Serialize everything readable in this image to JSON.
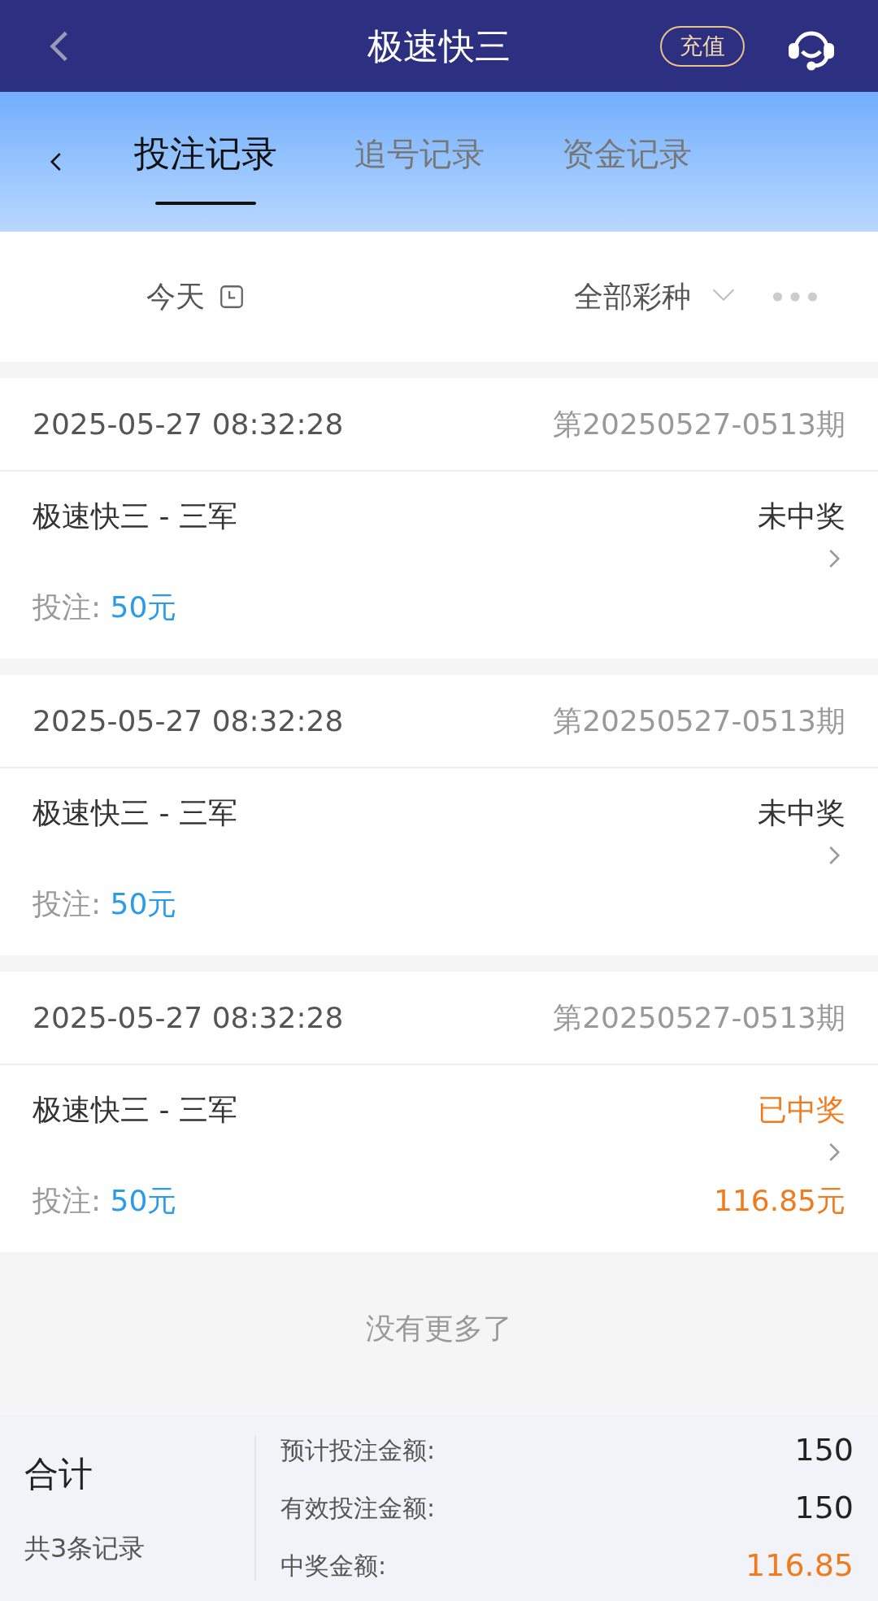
{
  "header": {
    "title": "极速快三",
    "recharge": "充值"
  },
  "tabs": [
    {
      "label": "投注记录",
      "selected": true
    },
    {
      "label": "追号记录",
      "selected": false
    },
    {
      "label": "资金记录",
      "selected": false
    }
  ],
  "filters": {
    "date": "今天",
    "lottery": "全部彩种"
  },
  "records": [
    {
      "time": "2025-05-27 08:32:28",
      "issue": "第20250527-0513期",
      "game": "极速快三 - 三军",
      "status": "未中奖",
      "won": false,
      "bet_label": "投注:",
      "bet": "50元"
    },
    {
      "time": "2025-05-27 08:32:28",
      "issue": "第20250527-0513期",
      "game": "极速快三 - 三军",
      "status": "未中奖",
      "won": false,
      "bet_label": "投注:",
      "bet": "50元"
    },
    {
      "time": "2025-05-27 08:32:28",
      "issue": "第20250527-0513期",
      "game": "极速快三 - 三军",
      "status": "已中奖",
      "won": true,
      "bet_label": "投注:",
      "bet": "50元",
      "prize": "116.85元"
    }
  ],
  "end_note": "没有更多了",
  "summary": {
    "title": "合计",
    "count": "共3条记录",
    "rows": [
      {
        "label": "预计投注金额:",
        "value": "150",
        "highlight": false
      },
      {
        "label": "有效投注金额:",
        "value": "150",
        "highlight": false
      },
      {
        "label": "中奖金额:",
        "value": "116.85",
        "highlight": true
      }
    ]
  }
}
